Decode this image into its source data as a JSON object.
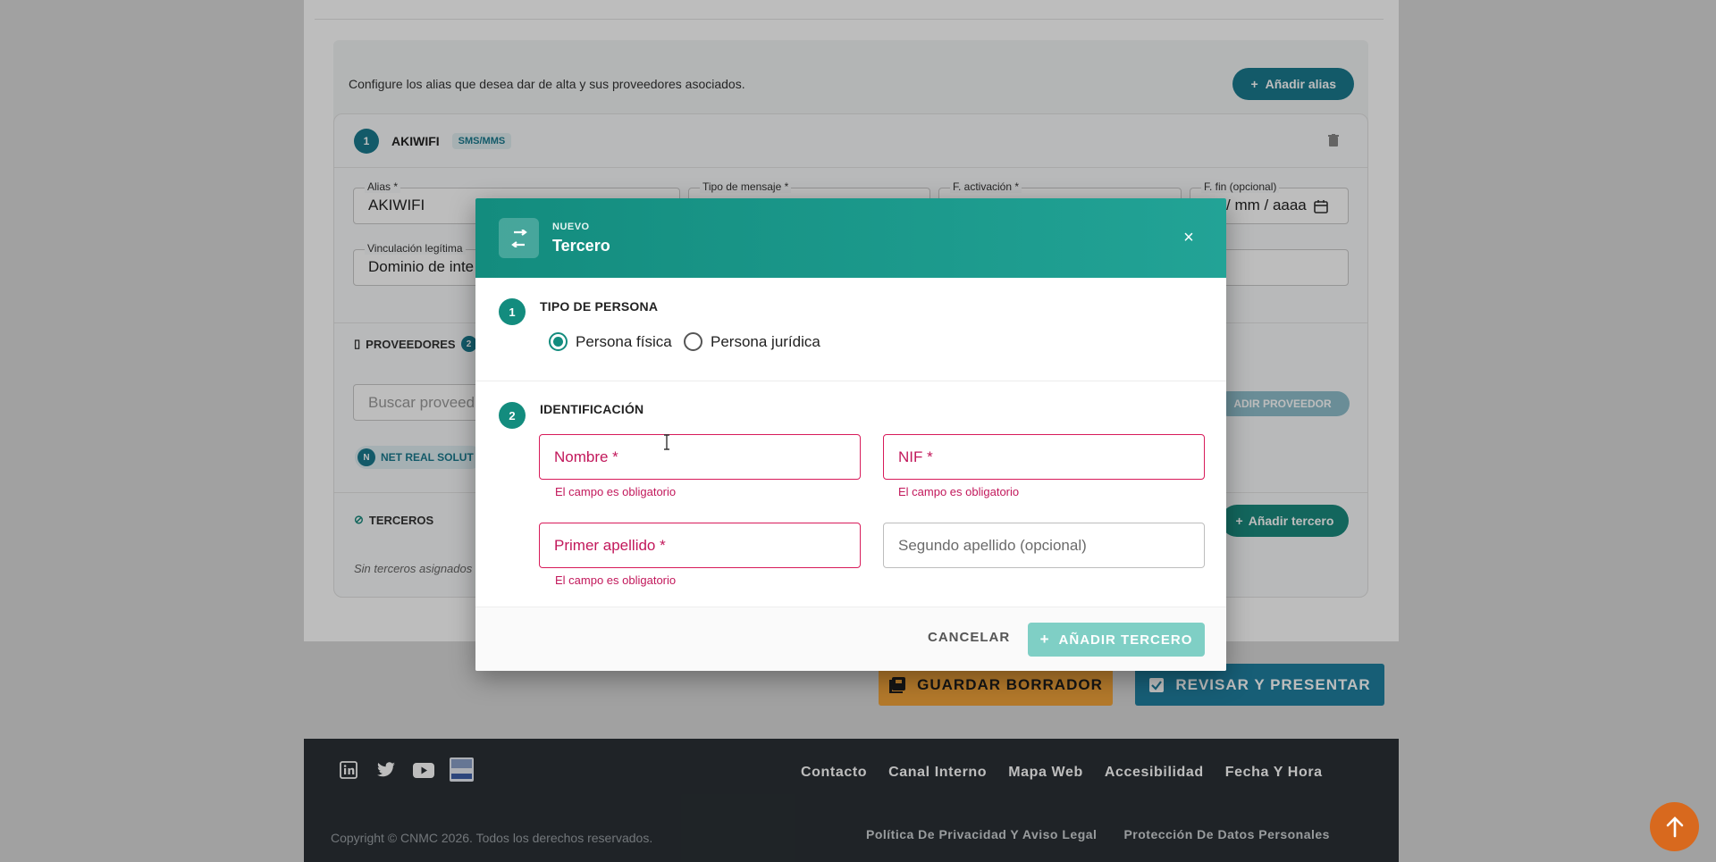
{
  "background": {
    "info_text": "Configure los alias que desea dar de alta y sus proveedores asociados.",
    "add_alias_label": "Añadir alias",
    "alias_card": {
      "number": "1",
      "name": "AKIWIFI",
      "tag": "SMS/MMS",
      "fields": {
        "alias_label": "Alias *",
        "alias_value": "AKIWIFI",
        "tipo_label": "Tipo de mensaje *",
        "activacion_label": "F. activación *",
        "fin_label": "F. fin (opcional)",
        "fin_value": "/ mm / aaaa",
        "vinculacion_label": "Vinculación legítima",
        "vinculacion_value": "Dominio de inte"
      },
      "providers_label": "PROVEEDORES",
      "providers_count": "2",
      "search_placeholder": "Buscar proveed",
      "add_provider_label": "ADIR PROVEEDOR",
      "provider_chip_letter": "N",
      "provider_chip_label": "NET REAL SOLUT",
      "terceros_label": "TERCEROS",
      "add_tercero_label": "Añadir tercero",
      "no_terceros": "Sin terceros asignados"
    },
    "save_draft_label": "GUARDAR BORRADOR",
    "review_label": "REVISAR Y PRESENTAR",
    "footer": {
      "links": [
        "Contacto",
        "Canal Interno",
        "Mapa Web",
        "Accesibilidad",
        "Fecha Y Hora"
      ],
      "sublinks": [
        "Política De Privacidad Y Aviso Legal",
        "Protección De Datos Personales"
      ],
      "copyright": "Copyright © CNMC 2026. Todos los derechos reservados.",
      "social_icons": [
        "linkedin-icon",
        "twitter-icon",
        "youtube-icon",
        "cnmc-blog-icon"
      ]
    }
  },
  "modal": {
    "subtitle": "NUEVO",
    "title": "Tercero",
    "close_symbol": "×",
    "step1": {
      "number": "1",
      "label": "TIPO DE PERSONA",
      "options": [
        {
          "label": "Persona física",
          "selected": true
        },
        {
          "label": "Persona jurídica",
          "selected": false
        }
      ]
    },
    "step2": {
      "number": "2",
      "label": "IDENTIFICACIÓN",
      "nombre_placeholder": "Nombre *",
      "nif_placeholder": "NIF *",
      "apellido1_placeholder": "Primer apellido *",
      "apellido2_placeholder": "Segundo apellido (opcional)",
      "error_text": "El campo es obligatorio"
    },
    "cancel_label": "CANCELAR",
    "add_label": "AÑADIR TERCERO"
  },
  "colors": {
    "accent": "#138c7e",
    "error": "#c2185b",
    "save": "#f2a43a",
    "review": "#1f7fa0",
    "fab": "#d8691e"
  }
}
